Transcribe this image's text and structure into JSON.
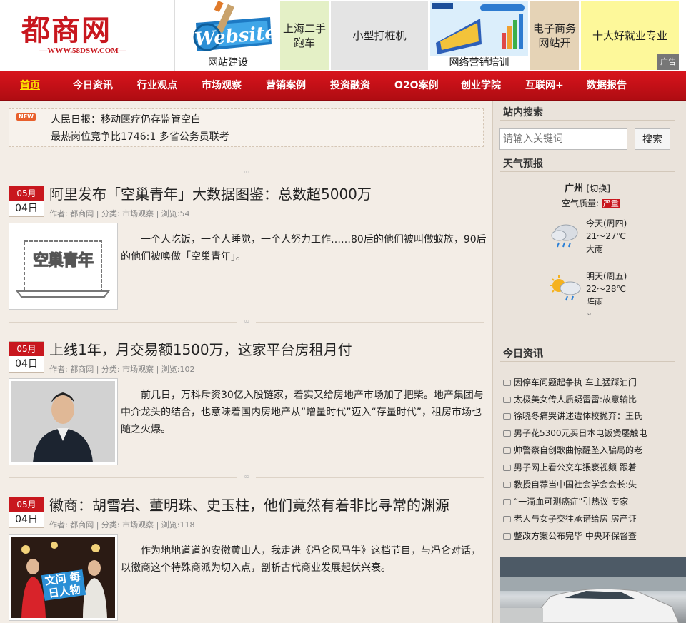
{
  "logo": {
    "main": "都商网",
    "sub": "—WWW.58DSW.COM—"
  },
  "ads": [
    {
      "label": "网站建设",
      "graphic_text": "Website"
    },
    {
      "label": "上海二手跑车"
    },
    {
      "label": "小型打桩机"
    },
    {
      "label": "网络营销培训"
    },
    {
      "label": "电子商务网站开"
    },
    {
      "label": "十大好就业专业"
    }
  ],
  "ad_tag": "广告",
  "nav": [
    "首页",
    "今日资讯",
    "行业观点",
    "市场观察",
    "营销案例",
    "投资融资",
    "O2O案例",
    "创业学院",
    "互联网+",
    "数据报告"
  ],
  "notice": {
    "badge": "NEW",
    "lines": [
      "人民日报：移动医疗仍存监管空白",
      "最热岗位竞争比1746:1 多省公务员联考"
    ]
  },
  "articles": [
    {
      "month": "05月",
      "day": "04日",
      "title": "阿里发布「空巢青年」大数据图鉴：总数超5000万",
      "meta": "作者: 都商网 | 分类: 市场观察 | 浏览:54",
      "summary": "一个人吃饭，一个人睡觉，一个人努力工作……80后的他们被叫做蚁族，90后的他们被唤做「空巢青年」。",
      "thumb_text": "空巢青年"
    },
    {
      "month": "05月",
      "day": "04日",
      "title": "上线1年，月交易额1500万，这家平台房租月付",
      "meta": "作者: 都商网 | 分类: 市场观察 | 浏览:102",
      "summary": "前几日，万科斥资30亿入股链家，着实又给房地产市场加了把柴。地产集团与中介龙头的结合，也意味着国内房地产从“增量时代”迈入“存量时代”，租房市场也随之火爆。"
    },
    {
      "month": "05月",
      "day": "04日",
      "title": "徽商：胡雪岩、董明珠、史玉柱，他们竟然有着非比寻常的渊源",
      "meta": "作者: 都商网 | 分类: 市场观察 | 浏览:118",
      "summary": "作为地地道道的安徽黄山人，我走进《冯仑风马牛》这档节目，与冯仑对话，以徽商这个特殊商派为切入点，剖析古代商业发展起伏兴衰。",
      "thumb_text": "文问 每日人物"
    }
  ],
  "sidebar": {
    "search_heading": "站内搜索",
    "search_placeholder": "请输入关键词",
    "search_button": "搜索",
    "weather_heading": "天气预报",
    "city": "广州",
    "switch": "[切换]",
    "aq_label": "空气质量:",
    "aq_value": "严重",
    "forecast": [
      {
        "day": "今天(周四)",
        "temp": "21～27℃",
        "desc": "大雨",
        "icon": "rain-cloud-icon"
      },
      {
        "day": "明天(周五)",
        "temp": "22～28℃",
        "desc": "阵雨",
        "icon": "sun-rain-icon"
      }
    ],
    "news_heading": "今日资讯",
    "news": [
      "因停车问题起争执 车主猛踩油门",
      "太极美女传人质疑雷雷:故意输比",
      "徐晓冬痛哭讲述遭体校抛弃：王氏",
      "男子花5300元买日本电饭煲屡触电",
      "帅警察自创歌曲惊醒坠入骗局的老",
      "男子网上看公交车猥亵视频 跟着",
      "教授自荐当中国社会学会会长:失",
      "“一滴血可测癌症”引热议 专家",
      "老人与女子交往承诺给房 房产证",
      "整改方案公布完毕 中央环保督查"
    ]
  }
}
